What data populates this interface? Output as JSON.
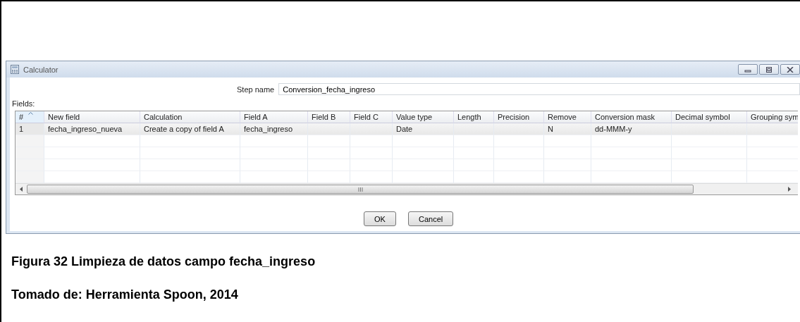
{
  "dialog": {
    "title": "Calculator",
    "step_name_label": "Step name",
    "step_name": "Conversion_fecha_ingreso",
    "fields_label": "Fields:",
    "table": {
      "columns": [
        {
          "label": "#",
          "sorted": true
        },
        {
          "label": "New field",
          "sorted": false
        },
        {
          "label": "Calculation",
          "sorted": false
        },
        {
          "label": "Field A",
          "sorted": false
        },
        {
          "label": "Field B",
          "sorted": false
        },
        {
          "label": "Field C",
          "sorted": false
        },
        {
          "label": "Value type",
          "sorted": false
        },
        {
          "label": "Length",
          "sorted": false
        },
        {
          "label": "Precision",
          "sorted": false
        },
        {
          "label": "Remove",
          "sorted": false
        },
        {
          "label": "Conversion mask",
          "sorted": false
        },
        {
          "label": "Decimal symbol",
          "sorted": false
        },
        {
          "label": "Grouping sym",
          "sorted": false
        }
      ],
      "rows": [
        {
          "selected": true,
          "cells": [
            "1",
            "fecha_ingreso_nueva",
            "Create a copy of field A",
            "fecha_ingreso",
            null,
            null,
            "Date",
            null,
            null,
            "N",
            "dd-MMM-y",
            null,
            null
          ]
        }
      ]
    },
    "buttons": [
      "OK",
      "Cancel"
    ]
  },
  "caption": {
    "figure": "Figura 32 Limpieza de datos campo fecha_ingreso",
    "source": "Tomado de: Herramienta Spoon, 2014"
  }
}
